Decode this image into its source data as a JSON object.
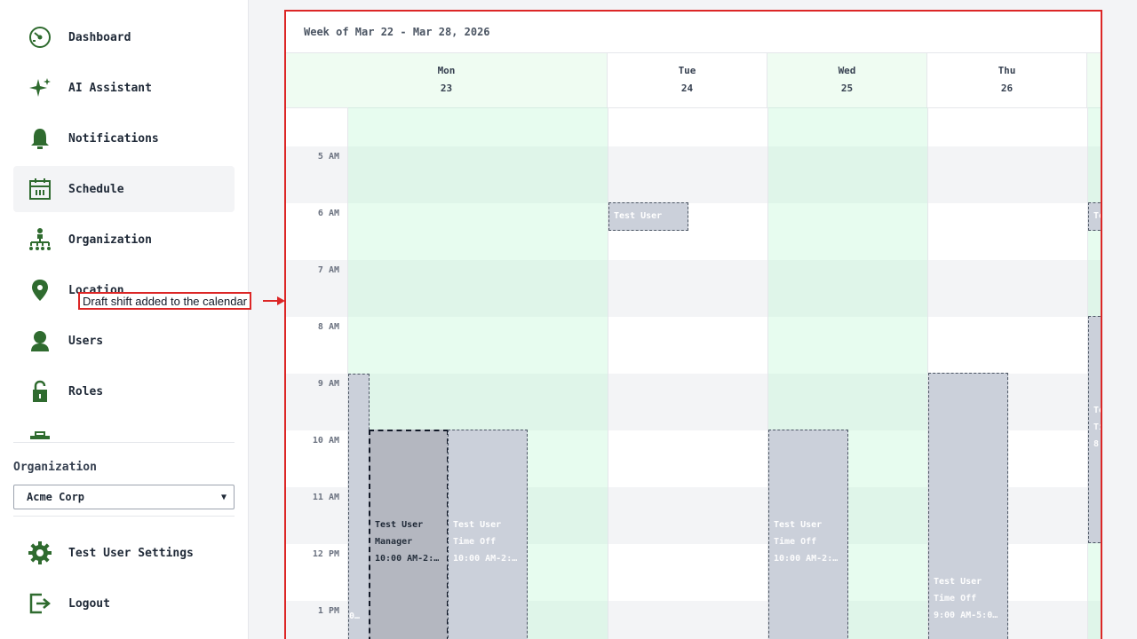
{
  "sidebar": {
    "items": [
      {
        "label": "Dashboard",
        "icon": "dashboard-icon"
      },
      {
        "label": "AI Assistant",
        "icon": "sparkle-icon"
      },
      {
        "label": "Notifications",
        "icon": "bell-icon"
      },
      {
        "label": "Schedule",
        "icon": "calendar-icon",
        "active": true
      },
      {
        "label": "Organization",
        "icon": "org-chart-icon"
      },
      {
        "label": "Location",
        "icon": "location-pin-icon"
      },
      {
        "label": "Users",
        "icon": "user-icon"
      },
      {
        "label": "Roles",
        "icon": "lock-icon"
      }
    ],
    "organization_label": "Organization",
    "organization_selected": "Acme Corp",
    "settings_label": "Test User Settings",
    "logout_label": "Logout"
  },
  "calendar": {
    "title": "Week of Mar 22 - Mar 28, 2026",
    "days": [
      {
        "name": "Mon",
        "date": "23"
      },
      {
        "name": "Tue",
        "date": "24"
      },
      {
        "name": "Wed",
        "date": "25"
      },
      {
        "name": "Thu",
        "date": "26"
      }
    ],
    "hours": [
      "5 AM",
      "6 AM",
      "7 AM",
      "8 AM",
      "9 AM",
      "10 AM",
      "11 AM",
      "12 PM",
      "1 PM"
    ],
    "shifts": [
      {
        "name": "Test User",
        "role": "Manager",
        "time": "10:00 AM-2:…",
        "draft": true
      },
      {
        "name": "Test User",
        "role": "Time Off",
        "time": "10:00 AM-2:…"
      },
      {
        "name": "Test User"
      },
      {
        "name": "Test User",
        "role": "Time Off",
        "time": "10:00 AM-2:…"
      },
      {
        "name": "Test User",
        "role": "Time Off",
        "time": "9:00 AM-5:0…"
      },
      {
        "time_fragment": "0…"
      },
      {
        "name_fragment": "Te"
      },
      {
        "name_fragment": "Te",
        "role_fragment": "Ti",
        "time_fragment": "8"
      }
    ]
  },
  "annotation": {
    "text": "Draft shift added to the calendar",
    "color": "#dc2626"
  },
  "colors": {
    "accent_green": "#2f6b2f",
    "column_tint": "#effcf2",
    "shift_fill": "#cbd0da",
    "draft_fill": "#b4b7c0"
  }
}
